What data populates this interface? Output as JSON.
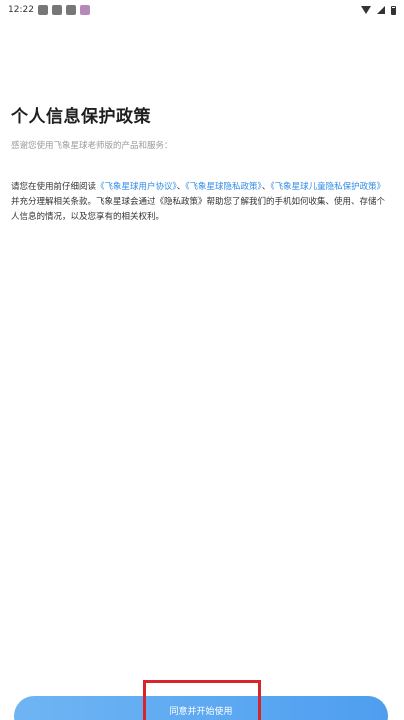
{
  "status_bar": {
    "time": "12:22",
    "colors": {
      "icons": "#333333"
    }
  },
  "page": {
    "title": "个人信息保护政策",
    "subtitle": "感谢您使用飞象星球老师版的产品和服务："
  },
  "policy": {
    "intro": "请您在使用前仔细阅读",
    "link_user_agreement": "《飞象星球用户协议》",
    "sep1": "、",
    "link_privacy_policy": "《飞象星球隐私政策》",
    "sep2": "、",
    "link_child_policy": "《飞象星球儿童隐私保护政策》",
    "middle": "并充分理解相关条款。飞象星球会通过",
    "privacy_ref": "《隐私政策》",
    "ending": "帮助您了解我们的手机如何收集、使用、存储个人信息的情况，以及您享有的相关权利。"
  },
  "footer": {
    "agree_label": "同意并开始使用"
  },
  "colors": {
    "link": "#2f8be6",
    "button": "#5aa8f1",
    "highlight": "#d7262b"
  }
}
